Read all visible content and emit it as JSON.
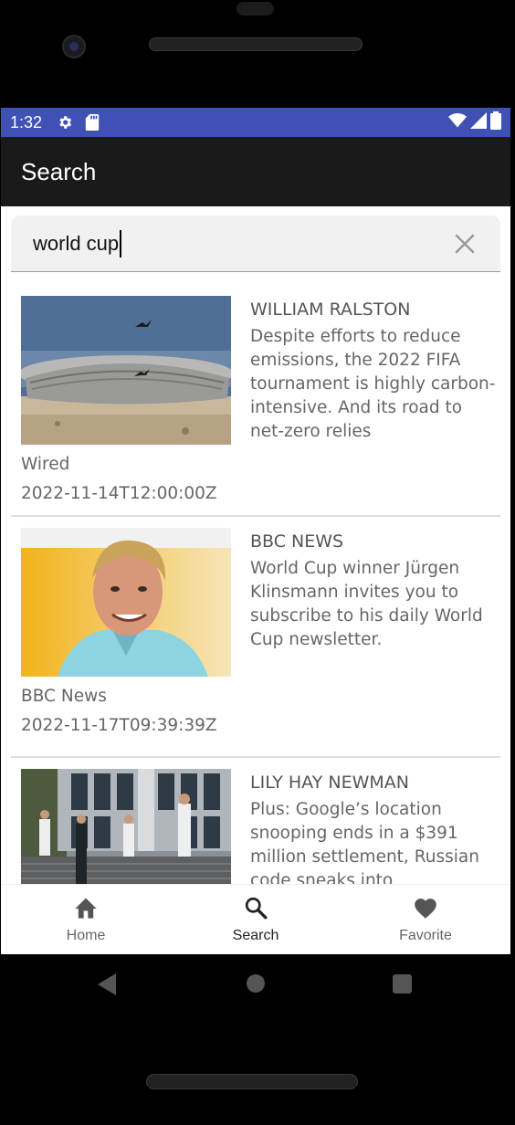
{
  "status_bar": {
    "time": "1:32",
    "icons": [
      "gear-icon",
      "sd-card-icon",
      "wifi-icon",
      "signal-icon",
      "battery-icon"
    ]
  },
  "app_bar": {
    "title": "Search"
  },
  "search": {
    "value": "world cup",
    "clear_icon": "close-icon"
  },
  "results": [
    {
      "author": "WILLIAM RALSTON",
      "description": "Despite efforts to reduce emissions, the 2022 FIFA tournament is highly carbon-intensive. And its road to net-zero relies",
      "source": "Wired",
      "date": "2022-11-14T12:00:00Z",
      "image": "stadium-photo"
    },
    {
      "author": "BBC NEWS",
      "description": "World Cup winner Jürgen Klinsmann invites you to subscribe to his daily World Cup newsletter.",
      "source": "BBC News",
      "date": "2022-11-17T09:39:39Z",
      "image": "portrait-photo"
    },
    {
      "author": "LILY HAY NEWMAN",
      "description": "Plus: Google’s location snooping ends in a $391 million settlement, Russian code sneaks into",
      "source": "",
      "date": "",
      "image": "guards-photo"
    }
  ],
  "bottom_nav": {
    "items": [
      {
        "label": "Home",
        "icon": "home-icon"
      },
      {
        "label": "Search",
        "icon": "search-icon"
      },
      {
        "label": "Favorite",
        "icon": "heart-icon"
      }
    ],
    "active": "Search"
  },
  "colors": {
    "status_bar": "#3f51b5",
    "app_bar": "#1a1a1a",
    "search_bg": "#f1f1f1"
  }
}
